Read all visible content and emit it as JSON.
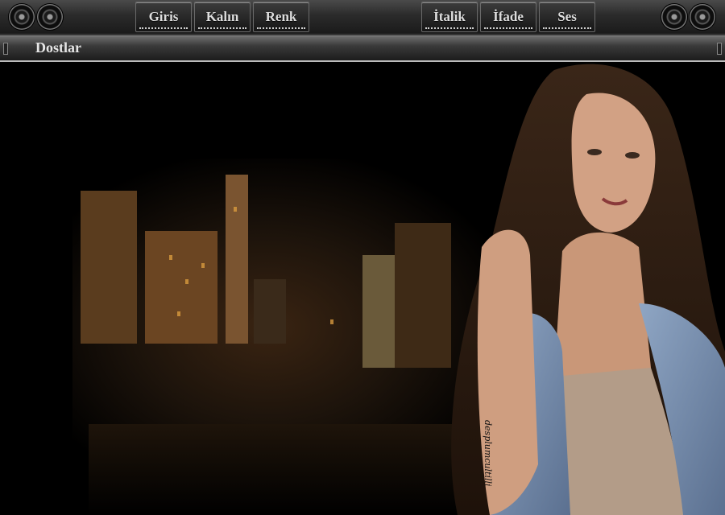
{
  "toolbar": {
    "left_buttons": [
      "Giris",
      "Kalın",
      "Renk"
    ],
    "right_buttons": [
      "İtalik",
      "İfade",
      "Ses"
    ],
    "icons": [
      "speaker-icon",
      "speaker-icon",
      "speaker-icon",
      "speaker-icon"
    ]
  },
  "bar2": {
    "label": "Dostlar"
  },
  "scene": {
    "tattoo_text": "desplumcultilli"
  },
  "colors": {
    "toolbar": "#2b2b2b",
    "accent": "#d89a3e",
    "background": "#000000"
  }
}
